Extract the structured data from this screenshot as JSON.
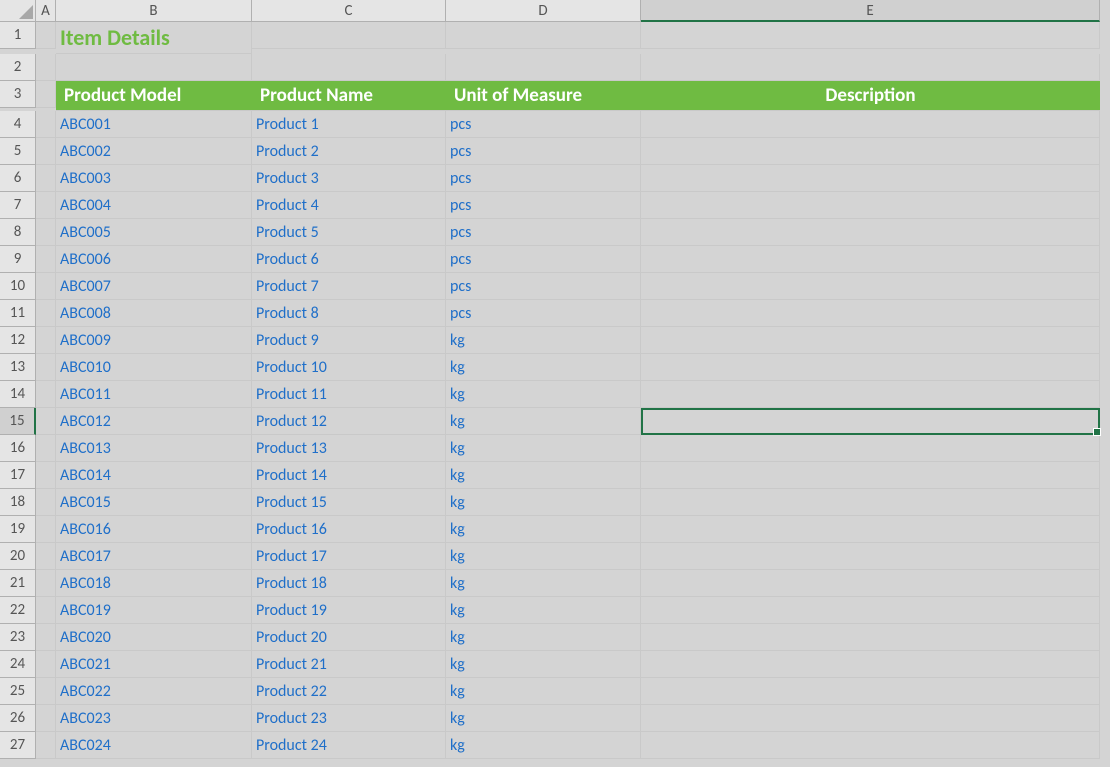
{
  "columns": [
    "A",
    "B",
    "C",
    "D",
    "E"
  ],
  "title": "Item Details",
  "headers": {
    "product_model": "Product Model",
    "product_name": "Product Name",
    "unit_of_measure": "Unit of Measure",
    "description": "Description"
  },
  "rows": [
    {
      "model": "ABC001",
      "name": "Product 1",
      "uom": "pcs",
      "desc": ""
    },
    {
      "model": "ABC002",
      "name": "Product 2",
      "uom": "pcs",
      "desc": ""
    },
    {
      "model": "ABC003",
      "name": "Product 3",
      "uom": "pcs",
      "desc": ""
    },
    {
      "model": "ABC004",
      "name": "Product 4",
      "uom": "pcs",
      "desc": ""
    },
    {
      "model": "ABC005",
      "name": "Product 5",
      "uom": "pcs",
      "desc": ""
    },
    {
      "model": "ABC006",
      "name": "Product 6",
      "uom": "pcs",
      "desc": ""
    },
    {
      "model": "ABC007",
      "name": "Product 7",
      "uom": "pcs",
      "desc": ""
    },
    {
      "model": "ABC008",
      "name": "Product 8",
      "uom": "pcs",
      "desc": ""
    },
    {
      "model": "ABC009",
      "name": "Product 9",
      "uom": "kg",
      "desc": ""
    },
    {
      "model": "ABC010",
      "name": "Product 10",
      "uom": "kg",
      "desc": ""
    },
    {
      "model": "ABC011",
      "name": "Product 11",
      "uom": "kg",
      "desc": ""
    },
    {
      "model": "ABC012",
      "name": "Product 12",
      "uom": "kg",
      "desc": ""
    },
    {
      "model": "ABC013",
      "name": "Product 13",
      "uom": "kg",
      "desc": ""
    },
    {
      "model": "ABC014",
      "name": "Product 14",
      "uom": "kg",
      "desc": ""
    },
    {
      "model": "ABC015",
      "name": "Product 15",
      "uom": "kg",
      "desc": ""
    },
    {
      "model": "ABC016",
      "name": "Product 16",
      "uom": "kg",
      "desc": ""
    },
    {
      "model": "ABC017",
      "name": "Product 17",
      "uom": "kg",
      "desc": ""
    },
    {
      "model": "ABC018",
      "name": "Product 18",
      "uom": "kg",
      "desc": ""
    },
    {
      "model": "ABC019",
      "name": "Product 19",
      "uom": "kg",
      "desc": ""
    },
    {
      "model": "ABC020",
      "name": "Product 20",
      "uom": "kg",
      "desc": ""
    },
    {
      "model": "ABC021",
      "name": "Product 21",
      "uom": "kg",
      "desc": ""
    },
    {
      "model": "ABC022",
      "name": "Product 22",
      "uom": "kg",
      "desc": ""
    },
    {
      "model": "ABC023",
      "name": "Product 23",
      "uom": "kg",
      "desc": ""
    },
    {
      "model": "ABC024",
      "name": "Product 24",
      "uom": "kg",
      "desc": ""
    }
  ],
  "selected_cell": "E15",
  "row_numbers": [
    "1",
    "2",
    "3",
    "4",
    "5",
    "6",
    "7",
    "8",
    "9",
    "10",
    "11",
    "12",
    "13",
    "14",
    "15",
    "16",
    "17",
    "18",
    "19",
    "20",
    "21",
    "22",
    "23",
    "24",
    "25",
    "26",
    "27"
  ]
}
